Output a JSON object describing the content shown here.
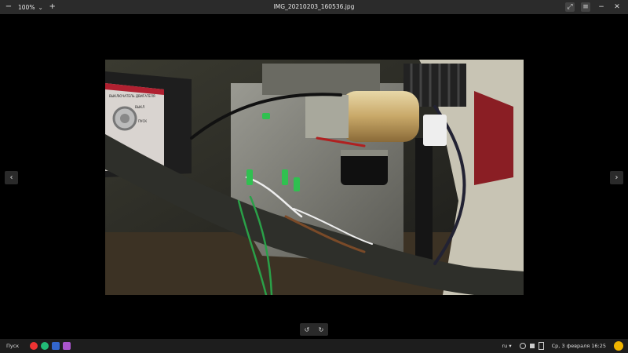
{
  "titlebar": {
    "zoom_out": "−",
    "zoom_level": "100%",
    "zoom_menu": "⌄",
    "zoom_in": "+",
    "title": "IMG_20210203_160536.jpg",
    "fullscreen_icon": "⤢",
    "menu_icon": "≡",
    "minimize_icon": "−",
    "close_icon": "✕"
  },
  "photo": {
    "label_lines": [
      "ВЫКЛЮЧАТЕЛЬ ДВИГАТЕЛЯ",
      "ВЫКЛ",
      "ПУСК"
    ]
  },
  "nav": {
    "prev": "‹",
    "next": "›"
  },
  "rotate": {
    "left": "↺",
    "right": "↻"
  },
  "taskbar": {
    "start": "Пуск",
    "lang": "ru",
    "lang_arrow": "▾",
    "datetime": "Ср, 3 февраля  16:25"
  },
  "colors": {
    "titlebar_bg": "#2b2b2b",
    "taskbar_bg": "#1d1d1d",
    "accent_sun": "#f0b400"
  }
}
